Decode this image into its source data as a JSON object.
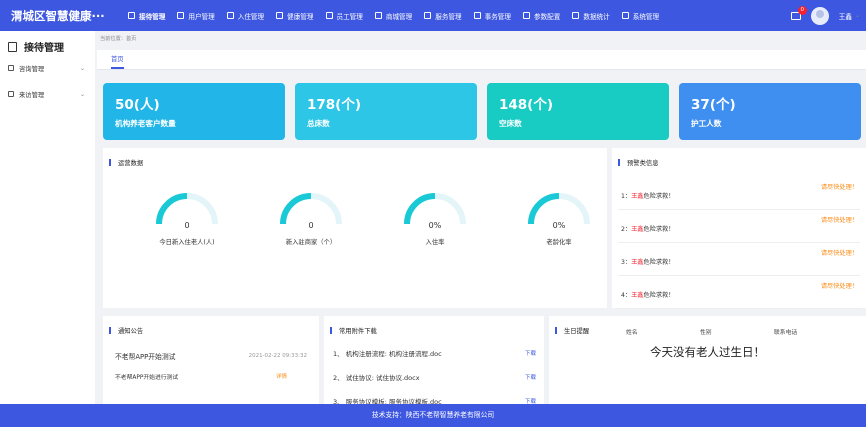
{
  "brand": "渭城区智慧健康···",
  "nav": [
    {
      "label": "接待管理",
      "icon": "reception-icon",
      "active": true
    },
    {
      "label": "用户管理",
      "icon": "user-manage-icon"
    },
    {
      "label": "入住管理",
      "icon": "checkin-icon"
    },
    {
      "label": "健康管理",
      "icon": "health-icon"
    },
    {
      "label": "员工管理",
      "icon": "staff-icon"
    },
    {
      "label": "商城管理",
      "icon": "shop-icon"
    },
    {
      "label": "服务管理",
      "icon": "service-icon"
    },
    {
      "label": "事务管理",
      "icon": "affairs-icon"
    },
    {
      "label": "参数配置",
      "icon": "settings-icon"
    },
    {
      "label": "数据统计",
      "icon": "stats-icon"
    },
    {
      "label": "系统管理",
      "icon": "system-icon"
    }
  ],
  "mail_badge": "0",
  "user_name": "王鑫",
  "sidebar": {
    "title": "接待管理",
    "items": [
      {
        "label": "咨询管理"
      },
      {
        "label": "来访管理"
      }
    ]
  },
  "breadcrumb": "当前位置：首页",
  "tab": "首页",
  "stats": [
    {
      "value": "50(人)",
      "label": "机构养老客户数量",
      "color": "#21b6e7"
    },
    {
      "value": "178(个)",
      "label": "总床数",
      "color": "#2ec6e6"
    },
    {
      "value": "148(个)",
      "label": "空床数",
      "color": "#19ccc3"
    },
    {
      "value": "37(个)",
      "label": "护工人数",
      "color": "#3f8ff0"
    }
  ],
  "operation": {
    "title": "运营数据",
    "gauges": [
      {
        "value": "0",
        "label": "今日新入住老人(人)",
        "fraction": 0.5
      },
      {
        "value": "0",
        "label": "新入驻商家（个）",
        "fraction": 0.5
      },
      {
        "value": "0%",
        "label": "入住率",
        "fraction": 0.5
      },
      {
        "value": "0%",
        "label": "老龄化率",
        "fraction": 0.5
      }
    ]
  },
  "warnings": {
    "title": "预警类信息",
    "items": [
      {
        "index": "1：",
        "name": "王鑫",
        "text": "危险求救！",
        "action": "请尽快处理！"
      },
      {
        "index": "2：",
        "name": "王鑫",
        "text": "危险求救！",
        "action": "请尽快处理！"
      },
      {
        "index": "3：",
        "name": "王鑫",
        "text": "危险求救！",
        "action": "请尽快处理！"
      },
      {
        "index": "4：",
        "name": "王鑫",
        "text": "危险求救！",
        "action": "请尽快处理！"
      }
    ]
  },
  "notice": {
    "title": "通知公告",
    "items": [
      {
        "text": "不老帮APP开始测试",
        "date": "2021-02-22 09:33:32"
      },
      {
        "text": "不老帮APP开始进行测试",
        "detail": "详情"
      }
    ]
  },
  "downloads": {
    "title": "常用附件下载",
    "items": [
      {
        "text": "1、 机构注册流程: 机构注册流程.doc",
        "link": "下载"
      },
      {
        "text": "2、 试住协议: 试住协议.docx",
        "link": "下载"
      },
      {
        "text": "3、 服务协议模板: 服务协议模板.doc",
        "link": "下载"
      }
    ]
  },
  "birthday": {
    "title": "生日提醒",
    "cols": [
      "姓名",
      "性别",
      "联系电话"
    ],
    "empty": "今天没有老人过生日！"
  },
  "footer": "技术支持：陕西不老帮智慧养老有限公司"
}
